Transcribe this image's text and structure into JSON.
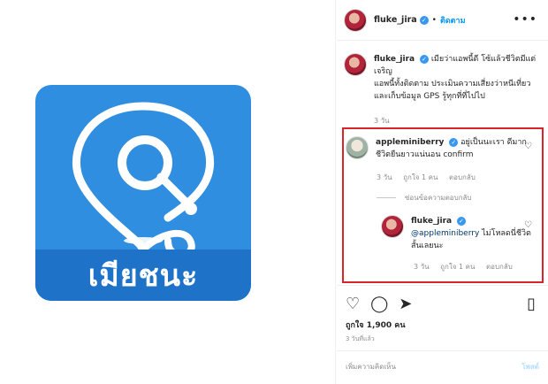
{
  "post": {
    "image_brand_text": "เมียชนะ",
    "header": {
      "username": "fluke_jira",
      "verified_icon": "verified-badge-icon",
      "separator": "•",
      "follow_label": "ติดตาม",
      "more_icon": "•••"
    },
    "caption": {
      "username": "fluke_jira",
      "text_line1": "เมียว่าแอพนี้ดี โซ้แล้วชีวิตมีแต่เจริญ",
      "text_line2": "แอพนี้ทั้งติดตาม ประเมินความเสี่ยงว่าหนีเที่ยว",
      "text_line3": "และเก็บข้อมูล GPS รู้ทุกที่ที่ไปไป",
      "time": "3 วัน"
    },
    "comment1": {
      "username": "appleminiberry",
      "text": "อยู่เป็นนะเรา ดีมาก ชีวิตยืนยาวแน่นอน confirm",
      "time": "3 วัน",
      "likes": "ถูกใจ 1 คน",
      "reply": "ตอบกลับ",
      "hide_replies": "ซ่อนข้อความตอบกลับ"
    },
    "comment2": {
      "username": "fluke_jira",
      "mention": "@appleminiberry",
      "text": "ไม่โหลดนี่ชีวิตสั้นเลยนะ",
      "time": "3 วัน",
      "likes": "ถูกใจ 1 คน",
      "reply": "ตอบกลับ"
    },
    "actions": {
      "like_icon": "♡",
      "comment_icon": "◯",
      "share_icon": "➤",
      "save_icon": "▯",
      "likes_count": "ถูกใจ 1,900 คน",
      "time": "3 วันที่แล้ว"
    },
    "add_comment": {
      "placeholder": "เพิ่มความคิดเห็น",
      "post_label": "โพสต์"
    }
  }
}
